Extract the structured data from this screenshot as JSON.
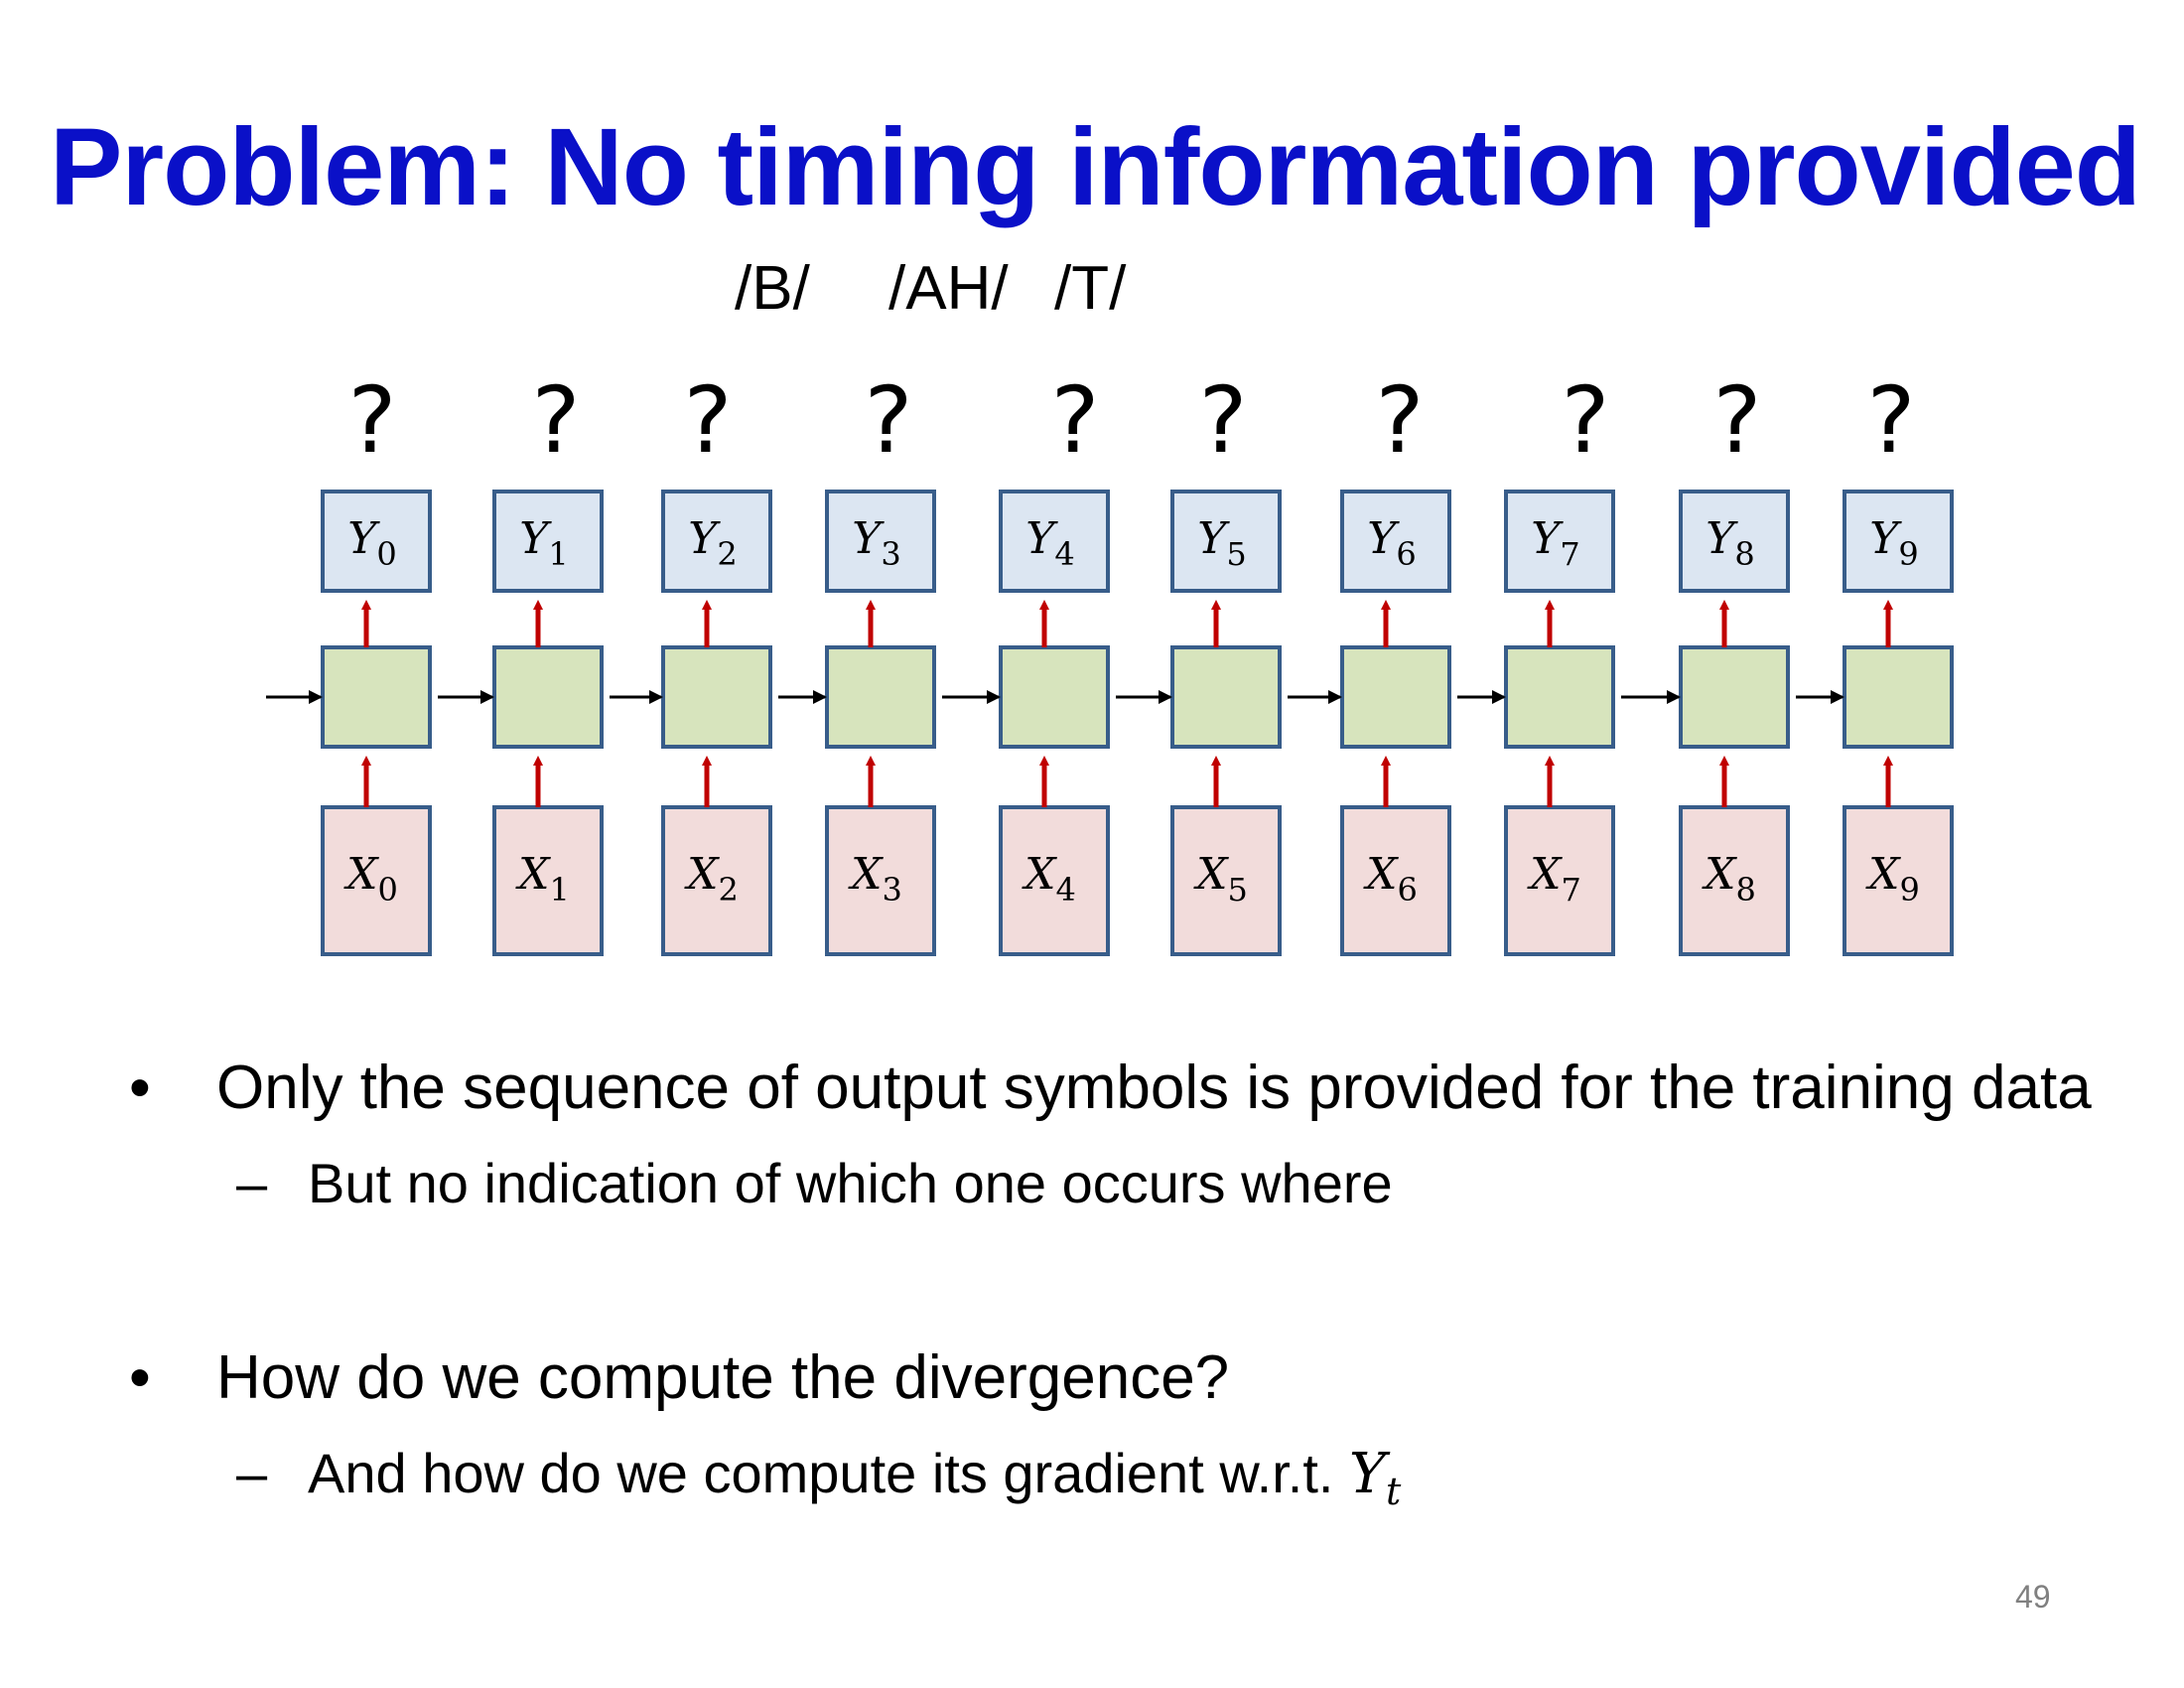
{
  "slide": {
    "title": "Problem: No timing information provided",
    "page_number": "49"
  },
  "phonemes": [
    "/B/",
    "/AH/",
    "/T/"
  ],
  "diagram": {
    "timesteps": 10,
    "question_mark": "?",
    "output_symbol": "Y",
    "input_symbol": "X",
    "subscripts": [
      "0",
      "1",
      "2",
      "3",
      "4",
      "5",
      "6",
      "7",
      "8",
      "9"
    ],
    "colors": {
      "output_fill": "#dce6f2",
      "hidden_fill": "#d7e4bd",
      "input_fill": "#f2dcdb",
      "box_stroke": "#385d8a",
      "vertical_arrow": "#c00000",
      "recurrent_arrow": "#000000"
    }
  },
  "bullets": [
    {
      "marker": "•",
      "text": "Only the sequence of output symbols is provided for the training data",
      "sub": {
        "marker": "–",
        "text": "But no indication of which one occurs where"
      }
    },
    {
      "marker": "•",
      "text": "How do we compute the divergence?",
      "sub": {
        "marker": "–",
        "text": "And how do we compute its gradient w.r.t. ",
        "math_symbol": "Y",
        "math_sub": "t"
      }
    }
  ]
}
